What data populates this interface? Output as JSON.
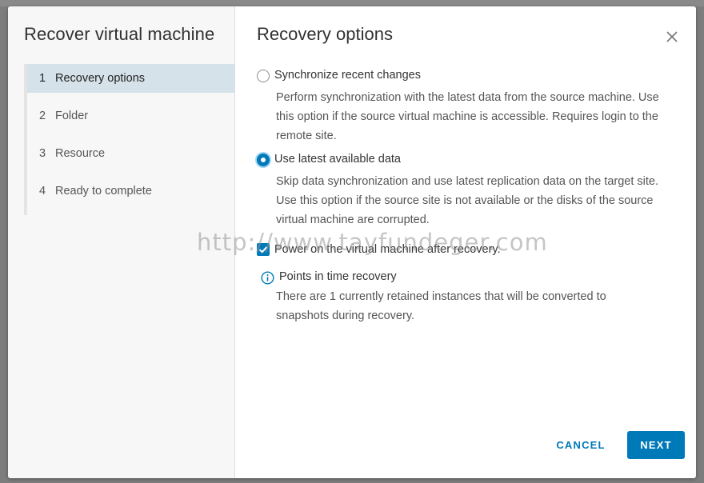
{
  "wizard": {
    "title": "Recover virtual machine",
    "steps": [
      {
        "num": "1",
        "label": "Recovery options"
      },
      {
        "num": "2",
        "label": "Folder"
      },
      {
        "num": "3",
        "label": "Resource"
      },
      {
        "num": "4",
        "label": "Ready to complete"
      }
    ],
    "active_step": 0
  },
  "page": {
    "title": "Recovery options",
    "options": [
      {
        "label": "Synchronize recent changes",
        "description": "Perform synchronization with the latest data from the source machine. Use this option if the source virtual machine is accessible. Requires login to the remote site.",
        "selected": false
      },
      {
        "label": "Use latest available data",
        "description": "Skip data synchronization and use latest replication data on the target site. Use this option if the source site is not available or the disks of the source virtual machine are corrupted.",
        "selected": true
      }
    ],
    "power_on": {
      "label": "Power on the virtual machine after recovery.",
      "checked": true
    },
    "info": {
      "title": "Points in time recovery",
      "text": "There are 1 currently retained instances that will be converted to snapshots during recovery."
    }
  },
  "watermark": "http://www.tayfundeger.com",
  "footer": {
    "cancel_label": "CANCEL",
    "next_label": "NEXT"
  },
  "icons": {
    "close": "close-icon",
    "info": "info-icon",
    "check": "check-icon"
  },
  "colors": {
    "accent": "#0079b8",
    "active_step_bg": "#d5e2ea"
  }
}
